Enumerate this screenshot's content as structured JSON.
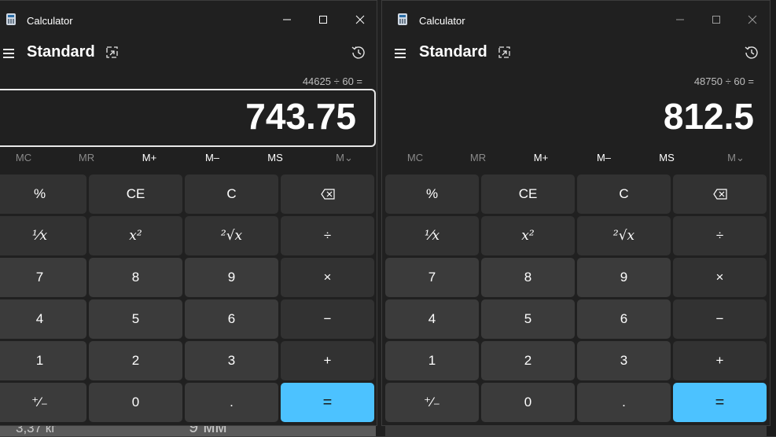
{
  "background": {
    "text_weight": "3,37 кг",
    "text_mm": "9 мм"
  },
  "windows": [
    {
      "app_title": "Calculator",
      "mode": "Standard",
      "expression": "44625 ÷ 60 =",
      "display": "743.75",
      "focused": true
    },
    {
      "app_title": "Calculator",
      "mode": "Standard",
      "expression": "48750 ÷ 60 =",
      "display": "812.5",
      "focused": false
    }
  ],
  "memory": [
    "MC",
    "MR",
    "M+",
    "M–",
    "MS",
    "M⌄"
  ],
  "keys": {
    "percent": "%",
    "ce": "CE",
    "c": "C",
    "reciprocal": "¹⁄x",
    "square": "x²",
    "sqrt": "²√x",
    "divide": "÷",
    "seven": "7",
    "eight": "8",
    "nine": "9",
    "multiply": "×",
    "four": "4",
    "five": "5",
    "six": "6",
    "minus": "−",
    "one": "1",
    "two": "2",
    "three": "3",
    "plus": "+",
    "negate": "⁺⁄₋",
    "zero": "0",
    "decimal": ".",
    "equals": "="
  },
  "colors": {
    "window_bg": "#202020",
    "key_bg": "#3b3b3b",
    "operator_bg": "#323232",
    "accent": "#4cc2ff"
  }
}
